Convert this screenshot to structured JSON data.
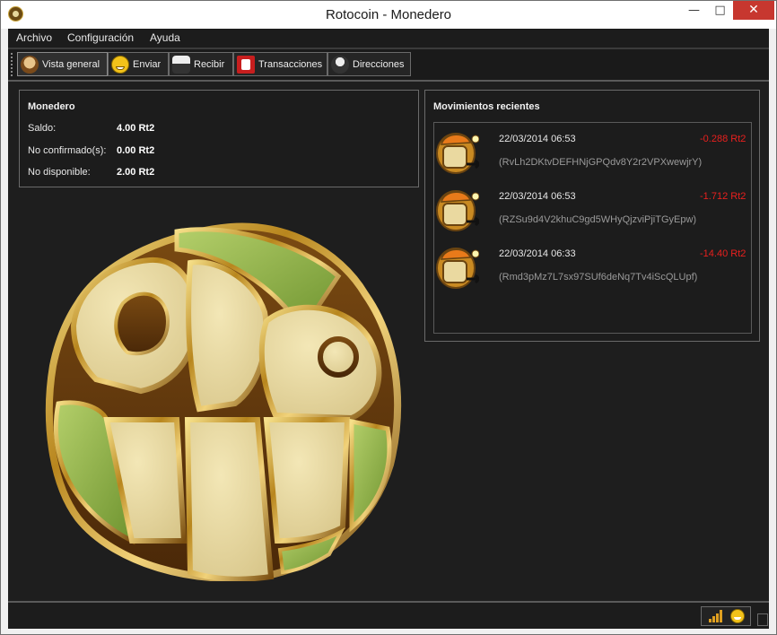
{
  "window": {
    "title": "Rotocoin - Monedero",
    "controls": {
      "minimize": "—",
      "maximize": "□",
      "close": "✕"
    }
  },
  "menu": [
    "Archivo",
    "Configuración",
    "Ayuda"
  ],
  "toolbar": [
    {
      "label": "Vista general",
      "icon": "miner-icon"
    },
    {
      "label": "Enviar",
      "icon": "smiley-icon"
    },
    {
      "label": "Recibir",
      "icon": "receive-icon"
    },
    {
      "label": "Transacciones",
      "icon": "tx-icon"
    },
    {
      "label": "Direcciones",
      "icon": "address-icon"
    }
  ],
  "wallet": {
    "title": "Monedero",
    "rows": [
      {
        "label": "Saldo:",
        "value": "4.00 Rt2"
      },
      {
        "label": "No confirmado(s):",
        "value": "0.00 Rt2"
      },
      {
        "label": "No disponible:",
        "value": "2.00 Rt2"
      }
    ]
  },
  "recent": {
    "title": "Movimientos recientes",
    "items": [
      {
        "date": "22/03/2014 06:53",
        "amount": "-0.288 Rt2",
        "address": "(RvLh2DKtvDEFHNjGPQdv8Y2r2VPXwewjrY)"
      },
      {
        "date": "22/03/2014 06:53",
        "amount": "-1.712 Rt2",
        "address": "(RZSu9d4V2khuC9gd5WHyQjzviPjiTGyEpw)"
      },
      {
        "date": "22/03/2014 06:33",
        "amount": "-14.40 Rt2",
        "address": "(Rmd3pMz7L7sx97SUf6deNq7Tv4iScQLUpf)"
      }
    ]
  },
  "colors": {
    "negative_amount": "#e8201e",
    "background": "#1e1e1e",
    "logo_gold": "#c9a43c",
    "logo_green": "#8db04a"
  }
}
